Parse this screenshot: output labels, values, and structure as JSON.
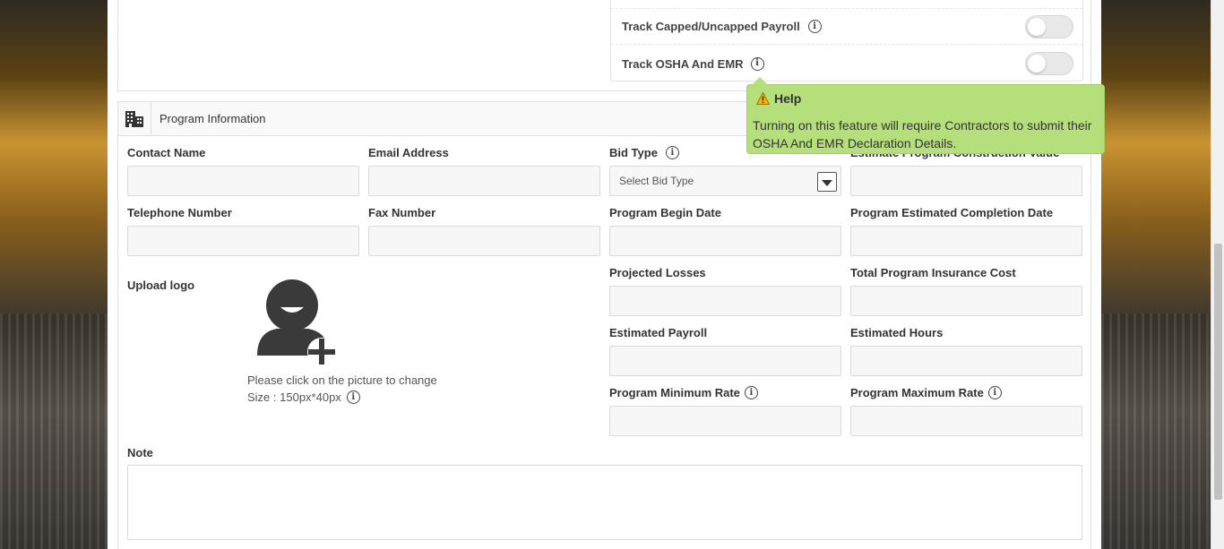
{
  "settings": {
    "row1_label": "Track Capped/Uncapped Payroll",
    "row2_label": "Track OSHA And EMR",
    "row1_on": false,
    "row2_on": false
  },
  "program": {
    "title": "Program Information",
    "contact_name": "Contact Name",
    "email_address": "Email Address",
    "bid_type": "Bid Type",
    "bid_type_placeholder": "Select Bid Type",
    "estimate_construction_value": "Estimate Program Construction Value",
    "telephone_number": "Telephone Number",
    "fax_number": "Fax Number",
    "program_begin_date": "Program Begin Date",
    "program_estimated_completion_date": "Program Estimated Completion Date",
    "projected_losses": "Projected Losses",
    "total_program_insurance_cost": "Total Program Insurance Cost",
    "estimated_payroll": "Estimated Payroll",
    "estimated_hours": "Estimated Hours",
    "program_minimum_rate": "Program Minimum Rate",
    "program_maximum_rate": "Program Maximum Rate",
    "upload_logo": "Upload logo",
    "upload_hint": "Please click on the picture to change",
    "upload_size": "Size : 150px*40px",
    "note": "Note"
  },
  "tooltip": {
    "title": "Help",
    "body": "Turning on this feature will require Contractors to submit their OSHA And EMR Declaration Details."
  },
  "colors": {
    "tooltip_bg": "#b5df7b",
    "input_bg": "#f7f7f7"
  }
}
